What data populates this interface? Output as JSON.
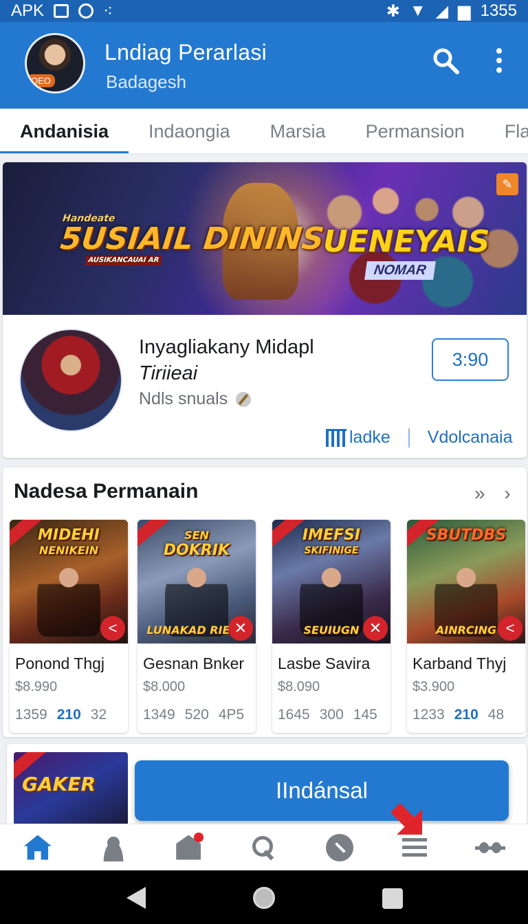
{
  "status_bar": {
    "carrier": "APK",
    "time": "1355"
  },
  "header": {
    "title": "Lndiag Perarlasi",
    "subtitle": "Badagesh",
    "avatar_badge": "OEO"
  },
  "tabs": [
    {
      "label": "Andanisia",
      "active": true
    },
    {
      "label": "Indaongia",
      "active": false
    },
    {
      "label": "Marsia",
      "active": false
    },
    {
      "label": "Permansion",
      "active": false
    },
    {
      "label": "Flar",
      "active": false
    }
  ],
  "featured": {
    "banner": {
      "left_logo_small": "Handeate",
      "left_logo": "5USIAIL DININS",
      "left_logo_tag": "AUSIKANCAUAI AR",
      "right_logo": "UENEYAIS",
      "right_logo_sub": "NOMAR"
    },
    "title_line1": "Inyagliakany Midapl",
    "title_line2": "Tiriieai",
    "meta": "Ndls snuals",
    "price": "3:90",
    "link_left": "ladke",
    "link_right": "Vdolcanaia"
  },
  "section": {
    "title": "Nadesa Permanain",
    "more": "»",
    "next": "›",
    "games": [
      {
        "art_title": "MIDEHI",
        "art_title2": "NENIKEIN",
        "art_sub": "",
        "name": "Ponond Thgj",
        "price": "$8.990",
        "stats": [
          "1359",
          "210",
          "32"
        ],
        "highlight": 1,
        "badge": "<"
      },
      {
        "art_title": "SEN",
        "art_title2": "DOKRIK",
        "art_sub": "LUNAKAD RIEEG",
        "name": "Gesnan Bnker",
        "price": "$8.000",
        "stats": [
          "1349",
          "520",
          "4P5"
        ],
        "highlight": -1,
        "badge": "✕"
      },
      {
        "art_title": "IMEFSI",
        "art_title2": "SKIFINIGE",
        "art_sub": "SEUIUGN",
        "name": "Lasbe Savira",
        "price": "$8.090",
        "stats": [
          "1645",
          "300",
          "145"
        ],
        "highlight": -1,
        "badge": "✕"
      },
      {
        "art_title": "SBUTDBS",
        "art_title2": "",
        "art_sub": "AINRCING",
        "name": "Karband Thyj",
        "price": "$3.900",
        "stats": [
          "1233",
          "210",
          "48"
        ],
        "highlight": 1,
        "badge": "<"
      }
    ]
  },
  "promo": {
    "art_text": "GAKER"
  },
  "cta": {
    "label": "IIndánsal"
  },
  "bottom_nav": [
    "home-icon",
    "profile-icon",
    "store-icon",
    "search-icon",
    "compass-icon",
    "menu-icon",
    "settings-icon"
  ],
  "colors": {
    "primary": "#2379d0",
    "status_bar": "#1c63b4",
    "accent_red": "#d3242b",
    "link": "#1f6fc2"
  }
}
